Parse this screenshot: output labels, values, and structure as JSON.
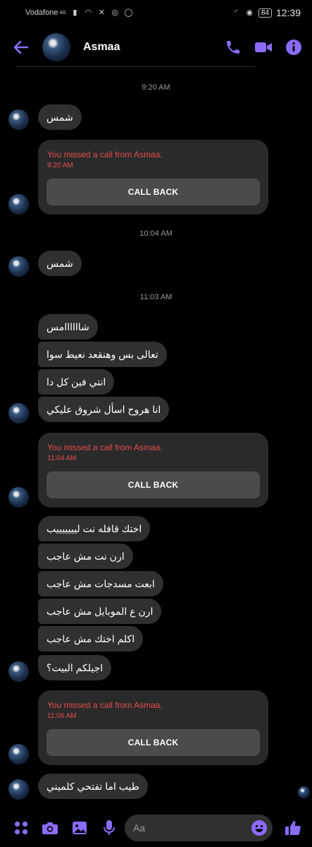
{
  "status_bar": {
    "carrier": "Vodafone",
    "network": "4G",
    "battery": "84",
    "time": "12:39"
  },
  "header": {
    "contact_name": "Asmaa"
  },
  "colors": {
    "accent": "#8a6cff",
    "missed_call": "#e74c4c",
    "bubble": "#303030",
    "card": "#2a2a2a",
    "button": "#4b4b4b"
  },
  "timestamps": {
    "t1": "9:20 AM",
    "t2": "10:04 AM",
    "t3": "11:03 AM"
  },
  "messages": {
    "m1": "شمس",
    "m2": "شمس",
    "m3": "شاااااامس",
    "m4": "تعالى بس وهنقعد نعيط سوا",
    "m5": "انتي فين كل دا",
    "m6": "انا هروح اسأل شروق عليكي",
    "m7": "اختك قافله نت ليييييييب",
    "m8": "ارن نت مش عاجب",
    "m9": "ابعت مسدجات مش عاجب",
    "m10": "ارن ع الموبايل مش عاجب",
    "m11": "اكلم اختك مش عاجب",
    "m12": "اجيلكم البيت؟",
    "m13": "طيب اما تفتحي كلميني"
  },
  "calls": [
    {
      "text": "You missed a call from Asmaa.",
      "time": "9:20 AM",
      "button": "CALL BACK"
    },
    {
      "text": "You missed a call from Asmaa.",
      "time": "11:04 AM",
      "button": "CALL BACK"
    },
    {
      "text": "You missed a call from Asmaa.",
      "time": "11:06 AM",
      "button": "CALL BACK"
    }
  ],
  "composer": {
    "placeholder": "Aa"
  },
  "icons": [
    "back-arrow-icon",
    "phone-icon",
    "video-camera-icon",
    "info-icon",
    "menu-grid-icon",
    "camera-icon",
    "gallery-icon",
    "microphone-icon",
    "emoji-icon",
    "thumbs-up-icon"
  ]
}
